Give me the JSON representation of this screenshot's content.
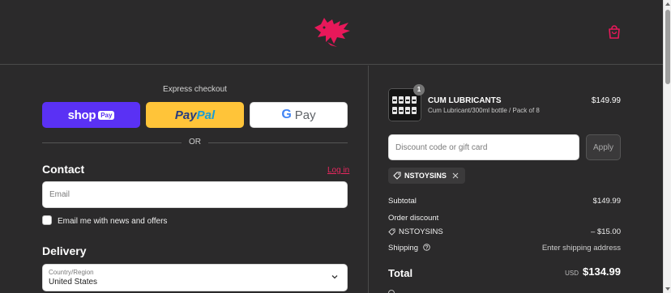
{
  "header": {
    "logo_icon": "dragon-logo",
    "cart_icon": "shopping-bag-icon",
    "brand_color": "#e8185a"
  },
  "express": {
    "title": "Express checkout",
    "shop_pay": {
      "main": "shop",
      "badge": "Pay",
      "color": "#5a31f4"
    },
    "paypal": {
      "part1": "Pay",
      "part2": "Pal",
      "color": "#ffc439"
    },
    "gpay": {
      "g": "G",
      "label": "Pay"
    },
    "or": "OR"
  },
  "contact": {
    "title": "Contact",
    "login": "Log in",
    "email_placeholder": "Email",
    "news_label": "Email me with news and offers"
  },
  "delivery": {
    "title": "Delivery",
    "country_label": "Country/Region",
    "country_value": "United States"
  },
  "product": {
    "name": "CUM LUBRICANTS",
    "variant": "Cum Lubricant/300ml bottle / Pack of 8",
    "price": "$149.99",
    "quantity": "1"
  },
  "discount": {
    "placeholder": "Discount code or gift card",
    "apply": "Apply",
    "applied_code": "NSTOYSINS"
  },
  "summary": {
    "subtotal_label": "Subtotal",
    "subtotal_value": "$149.99",
    "order_discount_label": "Order discount",
    "code": "NSTOYSINS",
    "discount_value": "– $15.00",
    "shipping_label": "Shipping",
    "shipping_value": "Enter shipping address",
    "total_label": "Total",
    "currency": "USD",
    "total_value": "$134.99"
  }
}
